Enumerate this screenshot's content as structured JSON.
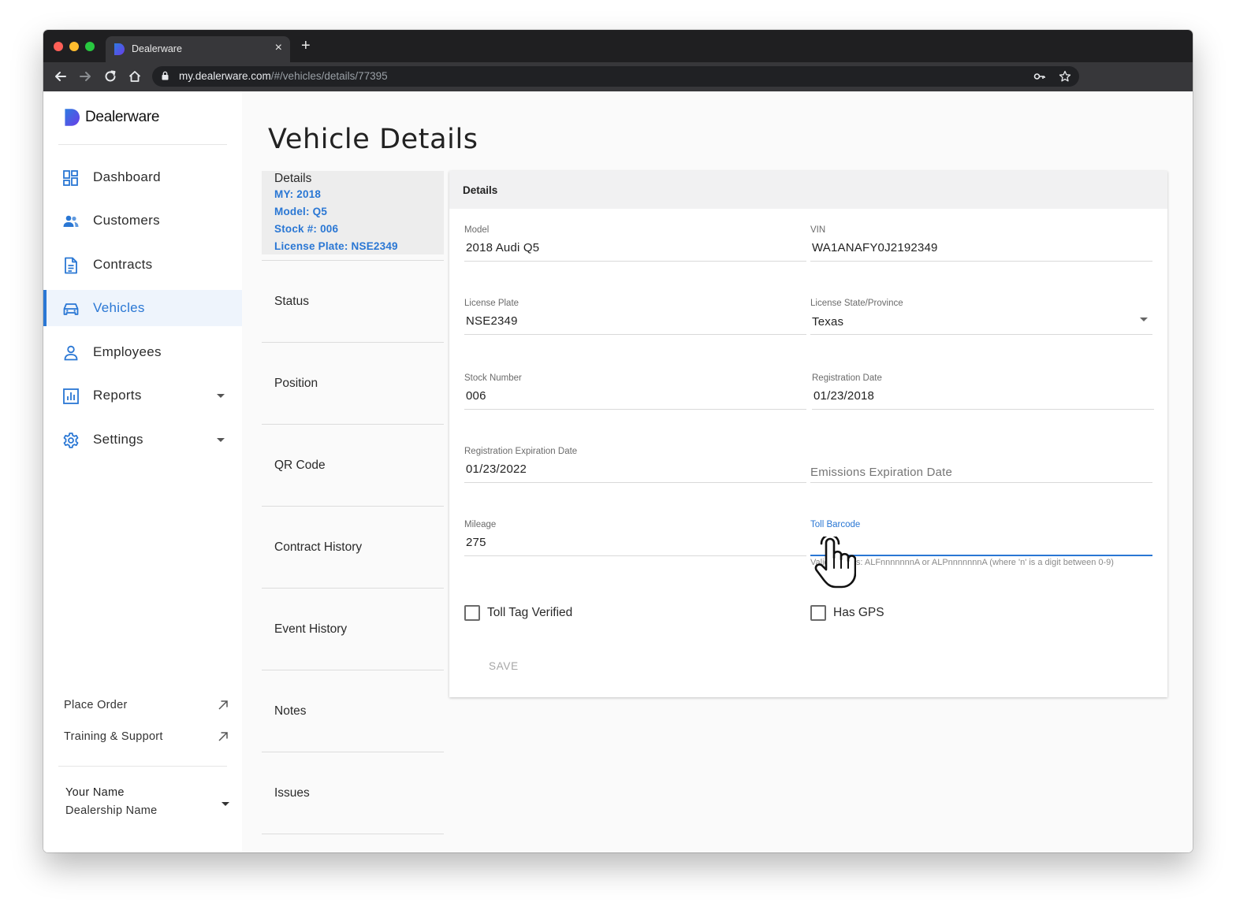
{
  "browser": {
    "tab_title": "Dealerware",
    "close_symbol": "×",
    "new_tab_symbol": "+",
    "url_host": "my.dealerware.com",
    "url_path": "/#/vehicles/details/77395",
    "traffic_lights": [
      "#fe5f57",
      "#febc2e",
      "#28c840"
    ]
  },
  "app": {
    "brand": "Dealerware",
    "accent_color": "#2a77d4"
  },
  "sidebar": {
    "items": [
      {
        "label": "Dashboard",
        "icon": "dashboard-icon"
      },
      {
        "label": "Customers",
        "icon": "customers-icon"
      },
      {
        "label": "Contracts",
        "icon": "contracts-icon"
      },
      {
        "label": "Vehicles",
        "icon": "car-icon",
        "active": true
      },
      {
        "label": "Employees",
        "icon": "person-icon"
      },
      {
        "label": "Reports",
        "icon": "reports-icon",
        "expandable": true
      },
      {
        "label": "Settings",
        "icon": "gear-icon",
        "expandable": true
      }
    ],
    "links": [
      {
        "label": "Place Order",
        "icon": "external-link-icon"
      },
      {
        "label": "Training & Support",
        "icon": "external-link-icon"
      }
    ],
    "user": {
      "name": "Your Name",
      "dealership": "Dealership Name"
    }
  },
  "page": {
    "title": "Vehicle Details"
  },
  "sections": {
    "summary": {
      "heading": "Details",
      "my": "MY: 2018",
      "model": "Model: Q5",
      "stock": "Stock #: 006",
      "plate": "License Plate: NSE2349"
    },
    "items": [
      "Status",
      "Position",
      "QR Code",
      "Contract History",
      "Event History",
      "Notes",
      "Issues"
    ]
  },
  "details_card": {
    "heading": "Details",
    "model": {
      "label": "Model",
      "value": "2018 Audi Q5"
    },
    "vin": {
      "label": "VIN",
      "value": "WA1ANAFY0J2192349"
    },
    "license_plate": {
      "label": "License Plate",
      "value": "NSE2349"
    },
    "license_state": {
      "label": "License State/Province",
      "value": "Texas"
    },
    "stock_number": {
      "label": "Stock Number",
      "value": "006"
    },
    "registration_date": {
      "label": "Registration Date",
      "value": "01/23/2018"
    },
    "registration_expiration": {
      "label": "Registration Expiration Date",
      "value": "01/23/2022"
    },
    "emissions_expiration": {
      "placeholder": "Emissions Expiration Date"
    },
    "mileage": {
      "label": "Mileage",
      "value": "275"
    },
    "toll_barcode": {
      "label": "Toll Barcode",
      "value": "",
      "helper": "Valid formats: ALFnnnnnnnA or ALPnnnnnnnA (where 'n' is a digit between 0-9)"
    },
    "toll_tag_verified": {
      "label": "Toll Tag Verified",
      "checked": false
    },
    "has_gps": {
      "label": "Has GPS",
      "checked": false
    },
    "save_label": "SAVE"
  }
}
